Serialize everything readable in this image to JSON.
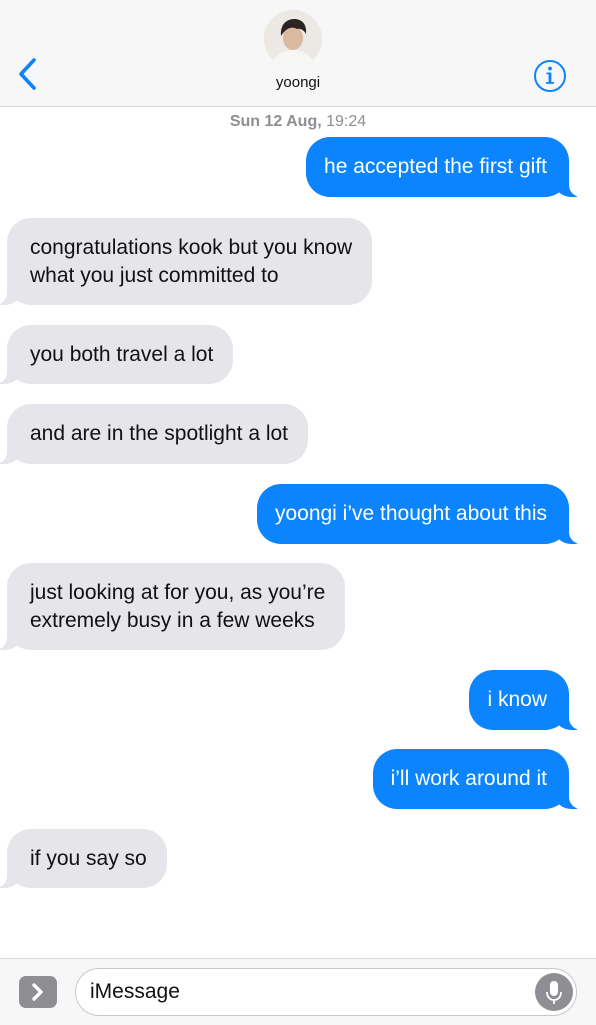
{
  "header": {
    "contact_name": "yoongi",
    "back_icon": "chevron-left-icon",
    "info_icon": "info-icon",
    "accent_color": "#0b84fe"
  },
  "timestamp": {
    "date": "Sun 12 Aug,",
    "time": "19:24"
  },
  "messages": [
    {
      "direction": "sent",
      "text": "he accepted the first gift"
    },
    {
      "direction": "received",
      "lines": [
        "congratulations kook but you know",
        "what you just committed to"
      ]
    },
    {
      "direction": "received",
      "text": "you both travel a lot"
    },
    {
      "direction": "received",
      "text": "and are in the spotlight a lot"
    },
    {
      "direction": "sent",
      "text": "yoongi i’ve thought about this"
    },
    {
      "direction": "received",
      "lines": [
        "just looking at for you, as you’re",
        "extremely busy in a few weeks"
      ]
    },
    {
      "direction": "sent",
      "text": "i know"
    },
    {
      "direction": "sent",
      "text": "i’ll work around it"
    },
    {
      "direction": "received",
      "text": "if you say so"
    }
  ],
  "composer": {
    "placeholder": "iMessage",
    "apps_icon": "chevron-right-icon",
    "mic_icon": "microphone-icon"
  },
  "colors": {
    "sent_bubble": "#0b84fe",
    "received_bubble": "#e5e5ea",
    "timestamp_gray": "#8e8e93"
  }
}
